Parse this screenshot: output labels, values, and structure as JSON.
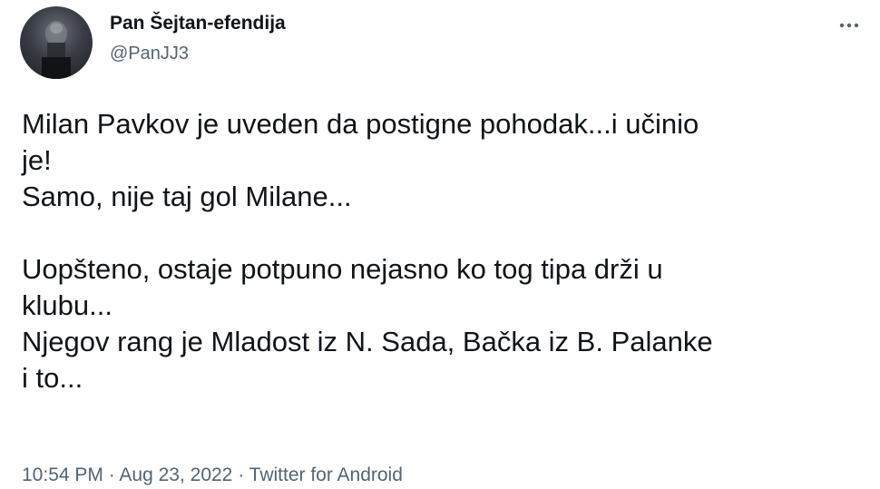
{
  "author": {
    "display_name": "Pan Šejtan-efendija",
    "handle": "@PanJJ3",
    "avatar_icon": "profile-photo"
  },
  "menu": {
    "icon": "more-horizontal-icon"
  },
  "tweet": {
    "lines": [
      "Milan Pavkov je uveden da postigne pohodak...i učinio",
      "je!",
      "Samo, nije taj gol Milane...",
      "",
      "Uopšteno, ostaje potpuno nejasno ko tog tipa drži u",
      "klubu...",
      "Njegov rang je Mladost iz N. Sada, Bačka iz B. Palanke",
      "i to..."
    ]
  },
  "meta": {
    "time": "10:54 PM",
    "separator": " · ",
    "date": "Aug 23, 2022",
    "source": "Twitter for Android"
  },
  "colors": {
    "text_primary": "#0f1419",
    "text_secondary": "#536471",
    "background": "#ffffff"
  }
}
